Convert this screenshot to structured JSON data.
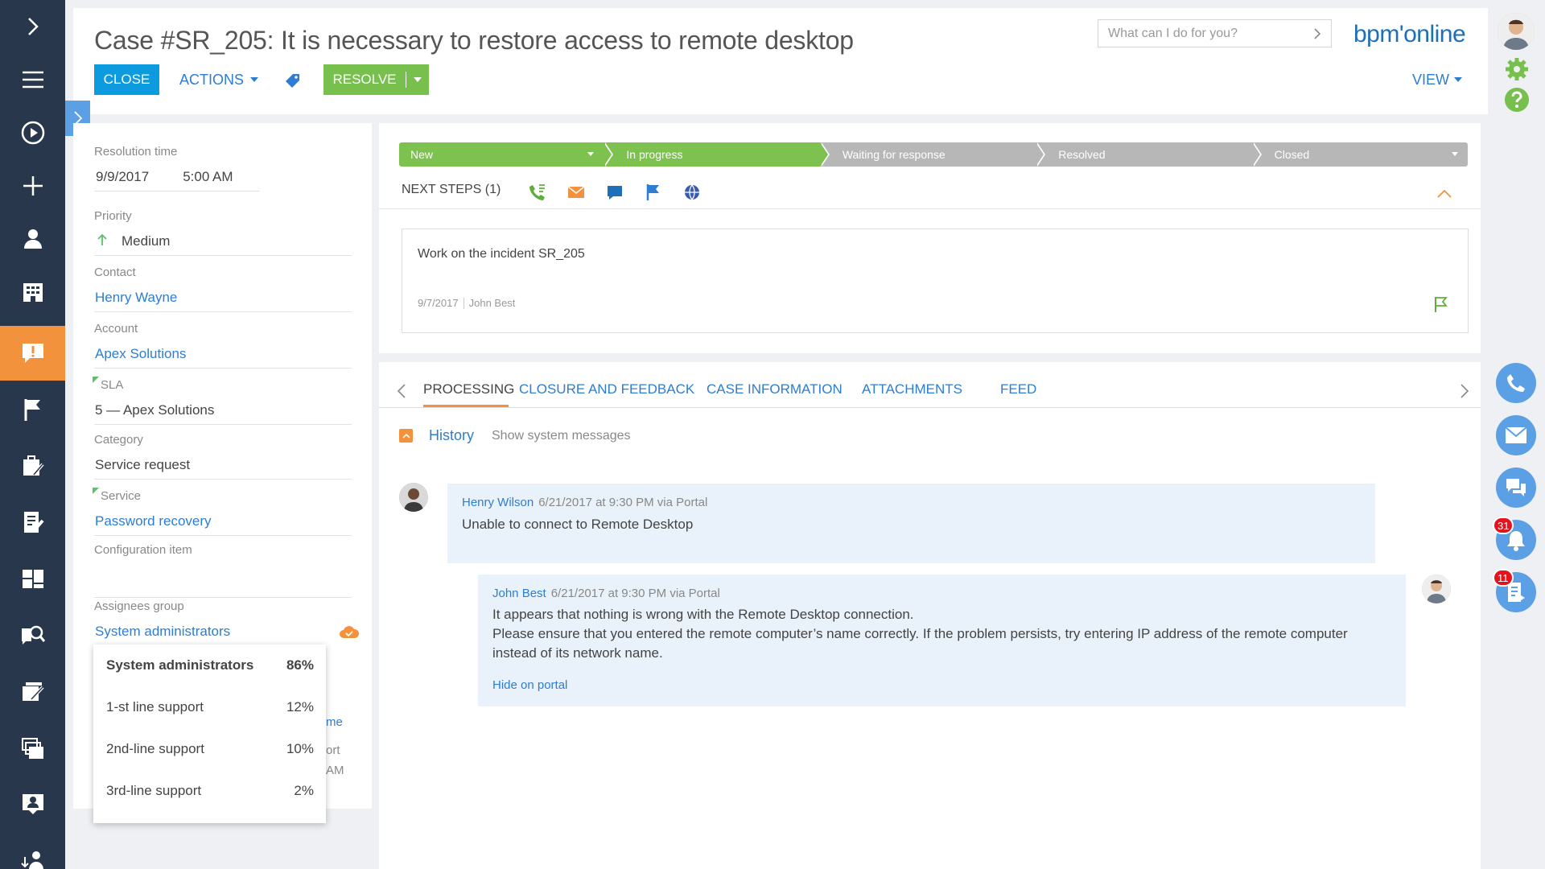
{
  "header": {
    "title": "Case #SR_205: It is necessary to restore access to remote desktop",
    "search_placeholder": "What can I do for you?",
    "logo": "bpm'online",
    "close_label": "CLOSE",
    "actions_label": "ACTIONS",
    "resolve_label": "RESOLVE",
    "view_label": "VIEW"
  },
  "fields": {
    "resolution_time": {
      "label": "Resolution time",
      "date": "9/9/2017",
      "time": "5:00 AM"
    },
    "priority": {
      "label": "Priority",
      "value": "Medium"
    },
    "contact": {
      "label": "Contact",
      "value": "Henry Wayne"
    },
    "account": {
      "label": "Account",
      "value": "Apex Solutions"
    },
    "sla": {
      "label": "SLA",
      "value": "5 — Apex Solutions"
    },
    "category": {
      "label": "Category",
      "value": "Service request"
    },
    "service": {
      "label": "Service",
      "value": "Password recovery"
    },
    "configuration_item": {
      "label": "Configuration item",
      "value": ""
    },
    "assignees_group": {
      "label": "Assignees group",
      "value": "System administrators"
    }
  },
  "assignee_popup": [
    {
      "name": "System administrators",
      "percent": "86%"
    },
    {
      "name": "1-st line support",
      "percent": "12%"
    },
    {
      "name": "2nd-line support",
      "percent": "10%"
    },
    {
      "name": "3rd-line support",
      "percent": "2%"
    }
  ],
  "hidden_fragments": {
    "a": "me",
    "b": "ort",
    "c": "AM"
  },
  "stages": [
    {
      "label": "New",
      "state": "done"
    },
    {
      "label": "In progress",
      "state": "done"
    },
    {
      "label": "Waiting for response",
      "state": "todo"
    },
    {
      "label": "Resolved",
      "state": "todo"
    },
    {
      "label": "Closed",
      "state": "todo"
    }
  ],
  "next_steps": {
    "label": "NEXT STEPS (1)",
    "task_title": "Work on the incident SR_205",
    "task_date": "9/7/2017",
    "task_owner": "John Best"
  },
  "tabs": [
    {
      "label": "PROCESSING",
      "active": true
    },
    {
      "label": "CLOSURE AND FEEDBACK"
    },
    {
      "label": "CASE INFORMATION"
    },
    {
      "label": "ATTACHMENTS"
    },
    {
      "label": "FEED"
    }
  ],
  "history": {
    "title": "History",
    "system_messages": "Show system messages",
    "messages": [
      {
        "author": "Henry Wilson",
        "meta": "6/21/2017 at 9:30 PM via Portal",
        "lines": [
          "Unable to connect to Remote Desktop"
        ]
      },
      {
        "author": "John Best",
        "meta": "6/21/2017 at 9:30 PM via Portal",
        "lines": [
          "It appears that nothing is wrong with the Remote Desktop connection.",
          "Please ensure that you entered the remote computer’s name correctly. If the problem persists, try entering IP address of the remote computer",
          "instead of its network name."
        ],
        "link": "Hide on portal"
      }
    ]
  },
  "right_bar": {
    "notifications_count": "31",
    "tasks_count": "11"
  },
  "colors": {
    "nav_bg": "#28374b",
    "nav_active": "#f2923c",
    "primary": "#0d9be0",
    "link": "#2d7dd2",
    "success": "#77c04d",
    "stage_done": "#7dc24f",
    "stage_todo": "#b7b7b7",
    "badge": "#e3141d"
  }
}
